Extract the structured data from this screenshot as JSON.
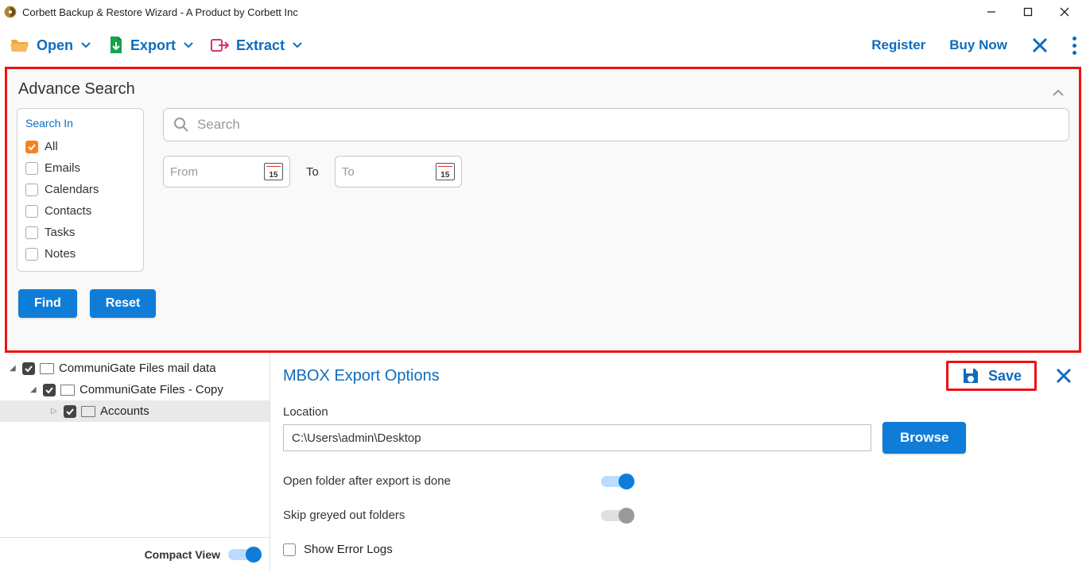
{
  "window": {
    "title": "Corbett Backup & Restore Wizard - A Product by Corbett Inc"
  },
  "toolbar": {
    "open": "Open",
    "export": "Export",
    "extract": "Extract",
    "register": "Register",
    "buy_now": "Buy Now"
  },
  "adv": {
    "title": "Advance Search",
    "search_in_label": "Search In",
    "items": [
      "All",
      "Emails",
      "Calendars",
      "Contacts",
      "Tasks",
      "Notes"
    ],
    "search_placeholder": "Search",
    "from_placeholder": "From",
    "to_label": "To",
    "to_placeholder": "To",
    "find": "Find",
    "reset": "Reset"
  },
  "tree": {
    "nodes": [
      {
        "label": "CommuniGate Files mail data"
      },
      {
        "label": "CommuniGate Files - Copy"
      },
      {
        "label": "Accounts"
      }
    ],
    "compact_view": "Compact View"
  },
  "options": {
    "title": "MBOX Export Options",
    "save": "Save",
    "location_label": "Location",
    "location_value": "C:\\Users\\admin\\Desktop",
    "browse": "Browse",
    "open_folder": "Open folder after export is done",
    "skip_greyed": "Skip greyed out folders",
    "show_error_logs": "Show Error Logs"
  }
}
